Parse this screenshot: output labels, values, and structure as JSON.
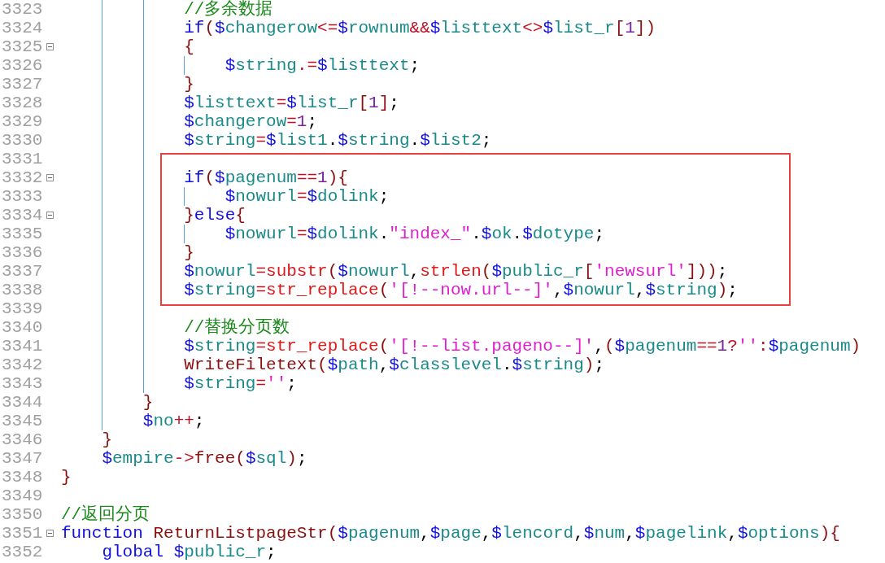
{
  "editor": {
    "blocks": [
      {
        "highlighted": false,
        "lines": [
          {
            "number": "3323",
            "tokens": [
              {
                "kind": "comment",
                "text": "            //多余数据"
              }
            ]
          },
          {
            "number": "3324",
            "tokens": [
              {
                "kind": "keyword",
                "text": "            if"
              },
              {
                "kind": "bracket",
                "text": "("
              },
              {
                "kind": "variable",
                "text": "$changerow"
              },
              {
                "kind": "operator",
                "text": "<="
              },
              {
                "kind": "variable",
                "text": "$rownum"
              },
              {
                "kind": "operator",
                "text": "&&"
              },
              {
                "kind": "variable",
                "text": "$listtext"
              },
              {
                "kind": "operator",
                "text": "<>"
              },
              {
                "kind": "variable",
                "text": "$list_r"
              },
              {
                "kind": "bracket",
                "text": "["
              },
              {
                "kind": "number",
                "text": "1"
              },
              {
                "kind": "bracket",
                "text": "]"
              },
              {
                "kind": "bracket",
                "text": ")"
              }
            ]
          },
          {
            "number": "3325",
            "fold": true,
            "tokens": [
              {
                "kind": "bracket",
                "text": "            {"
              }
            ]
          },
          {
            "number": "3326",
            "tokens": [
              {
                "kind": "variable",
                "text": "                $string"
              },
              {
                "kind": "operator",
                "text": ".="
              },
              {
                "kind": "variable",
                "text": "$listtext"
              },
              {
                "kind": "plain",
                "text": ";"
              }
            ]
          },
          {
            "number": "3327",
            "tokens": [
              {
                "kind": "bracket",
                "text": "            }"
              }
            ]
          },
          {
            "number": "3328",
            "tokens": [
              {
                "kind": "variable",
                "text": "            $listtext"
              },
              {
                "kind": "operator",
                "text": "="
              },
              {
                "kind": "variable",
                "text": "$list_r"
              },
              {
                "kind": "bracket",
                "text": "["
              },
              {
                "kind": "number",
                "text": "1"
              },
              {
                "kind": "bracket",
                "text": "]"
              },
              {
                "kind": "plain",
                "text": ";"
              }
            ]
          },
          {
            "number": "3329",
            "tokens": [
              {
                "kind": "variable",
                "text": "            $changerow"
              },
              {
                "kind": "operator",
                "text": "="
              },
              {
                "kind": "number",
                "text": "1"
              },
              {
                "kind": "plain",
                "text": ";"
              }
            ]
          },
          {
            "number": "3330",
            "tokens": [
              {
                "kind": "variable",
                "text": "            $string"
              },
              {
                "kind": "operator",
                "text": "="
              },
              {
                "kind": "variable",
                "text": "$list1"
              },
              {
                "kind": "plain",
                "text": "."
              },
              {
                "kind": "variable",
                "text": "$string"
              },
              {
                "kind": "plain",
                "text": "."
              },
              {
                "kind": "variable",
                "text": "$list2"
              },
              {
                "kind": "plain",
                "text": ";"
              }
            ]
          }
        ]
      },
      {
        "highlighted": true,
        "lines": [
          {
            "number": "3331"
          },
          {
            "number": "3332",
            "fold": true,
            "tokens": [
              {
                "kind": "keyword",
                "text": "            if"
              },
              {
                "kind": "bracket",
                "text": "("
              },
              {
                "kind": "variable",
                "text": "$pagenum"
              },
              {
                "kind": "operator",
                "text": "=="
              },
              {
                "kind": "number",
                "text": "1"
              },
              {
                "kind": "bracket",
                "text": ")"
              },
              {
                "kind": "bracket",
                "text": "{"
              }
            ]
          },
          {
            "number": "3333",
            "tokens": [
              {
                "kind": "variable",
                "text": "                $nowurl"
              },
              {
                "kind": "operator",
                "text": "="
              },
              {
                "kind": "variable",
                "text": "$dolink"
              },
              {
                "kind": "plain",
                "text": ";"
              }
            ]
          },
          {
            "number": "3334",
            "fold": true,
            "tokens": [
              {
                "kind": "bracket",
                "text": "            }"
              },
              {
                "kind": "keyword",
                "text": "else"
              },
              {
                "kind": "bracket",
                "text": "{"
              }
            ]
          },
          {
            "number": "3335",
            "tokens": [
              {
                "kind": "variable",
                "text": "                $nowurl"
              },
              {
                "kind": "operator",
                "text": "="
              },
              {
                "kind": "variable",
                "text": "$dolink"
              },
              {
                "kind": "plain",
                "text": "."
              },
              {
                "kind": "string",
                "text": "\"index_\""
              },
              {
                "kind": "plain",
                "text": "."
              },
              {
                "kind": "variable",
                "text": "$ok"
              },
              {
                "kind": "plain",
                "text": "."
              },
              {
                "kind": "variable",
                "text": "$dotype"
              },
              {
                "kind": "plain",
                "text": ";"
              }
            ]
          },
          {
            "number": "3336",
            "tokens": [
              {
                "kind": "bracket",
                "text": "            }"
              }
            ]
          },
          {
            "number": "3337",
            "tokens": [
              {
                "kind": "variable",
                "text": "            $nowurl"
              },
              {
                "kind": "operator",
                "text": "="
              },
              {
                "kind": "builtin",
                "text": "substr"
              },
              {
                "kind": "bracket",
                "text": "("
              },
              {
                "kind": "variable",
                "text": "$nowurl"
              },
              {
                "kind": "plain",
                "text": ","
              },
              {
                "kind": "builtin",
                "text": "strlen"
              },
              {
                "kind": "bracket",
                "text": "("
              },
              {
                "kind": "variable",
                "text": "$public_r"
              },
              {
                "kind": "bracket",
                "text": "["
              },
              {
                "kind": "string",
                "text": "'newsurl'"
              },
              {
                "kind": "bracket",
                "text": "]"
              },
              {
                "kind": "bracket",
                "text": ")"
              },
              {
                "kind": "bracket",
                "text": ")"
              },
              {
                "kind": "plain",
                "text": ";"
              }
            ]
          },
          {
            "number": "3338",
            "tokens": [
              {
                "kind": "variable",
                "text": "            $string"
              },
              {
                "kind": "operator",
                "text": "="
              },
              {
                "kind": "builtin",
                "text": "str_replace"
              },
              {
                "kind": "bracket",
                "text": "("
              },
              {
                "kind": "string",
                "text": "'[!--now.url--]'"
              },
              {
                "kind": "plain",
                "text": ","
              },
              {
                "kind": "variable",
                "text": "$nowurl"
              },
              {
                "kind": "plain",
                "text": ","
              },
              {
                "kind": "variable",
                "text": "$string"
              },
              {
                "kind": "bracket",
                "text": ")"
              },
              {
                "kind": "plain",
                "text": ";"
              }
            ]
          }
        ]
      },
      {
        "highlighted": false,
        "lines": [
          {
            "number": "3339"
          },
          {
            "number": "3340",
            "tokens": [
              {
                "kind": "comment",
                "text": "            //替换分页数"
              }
            ]
          },
          {
            "number": "3341",
            "tokens": [
              {
                "kind": "variable",
                "text": "            $string"
              },
              {
                "kind": "operator",
                "text": "="
              },
              {
                "kind": "builtin",
                "text": "str_replace"
              },
              {
                "kind": "bracket",
                "text": "("
              },
              {
                "kind": "string",
                "text": "'[!--list.pageno--]'"
              },
              {
                "kind": "plain",
                "text": ","
              },
              {
                "kind": "bracket",
                "text": "("
              },
              {
                "kind": "variable",
                "text": "$pagenum"
              },
              {
                "kind": "operator",
                "text": "=="
              },
              {
                "kind": "number",
                "text": "1"
              },
              {
                "kind": "operator",
                "text": "?"
              },
              {
                "kind": "string",
                "text": "''"
              },
              {
                "kind": "operator",
                "text": ":"
              },
              {
                "kind": "variable",
                "text": "$pagenum"
              },
              {
                "kind": "bracket",
                "text": ")"
              }
            ]
          },
          {
            "number": "3342",
            "tokens": [
              {
                "kind": "function",
                "text": "            WriteFiletext"
              },
              {
                "kind": "bracket",
                "text": "("
              },
              {
                "kind": "variable",
                "text": "$path"
              },
              {
                "kind": "plain",
                "text": ","
              },
              {
                "kind": "variable",
                "text": "$classlevel"
              },
              {
                "kind": "plain",
                "text": "."
              },
              {
                "kind": "variable",
                "text": "$string"
              },
              {
                "kind": "bracket",
                "text": ")"
              },
              {
                "kind": "plain",
                "text": ";"
              }
            ]
          },
          {
            "number": "3343",
            "tokens": [
              {
                "kind": "variable",
                "text": "            $string"
              },
              {
                "kind": "operator",
                "text": "="
              },
              {
                "kind": "string",
                "text": "''"
              },
              {
                "kind": "plain",
                "text": ";"
              }
            ]
          },
          {
            "number": "3344",
            "tokens": [
              {
                "kind": "bracket",
                "text": "        }"
              }
            ]
          },
          {
            "number": "3345",
            "tokens": [
              {
                "kind": "variable",
                "text": "        $no"
              },
              {
                "kind": "operator",
                "text": "++"
              },
              {
                "kind": "plain",
                "text": ";"
              }
            ]
          },
          {
            "number": "3346",
            "tokens": [
              {
                "kind": "bracket",
                "text": "    }"
              }
            ]
          },
          {
            "number": "3347",
            "tokens": [
              {
                "kind": "variable",
                "text": "    $empire"
              },
              {
                "kind": "operator",
                "text": "->"
              },
              {
                "kind": "function",
                "text": "free"
              },
              {
                "kind": "bracket",
                "text": "("
              },
              {
                "kind": "variable",
                "text": "$sql"
              },
              {
                "kind": "bracket",
                "text": ")"
              },
              {
                "kind": "plain",
                "text": ";"
              }
            ]
          },
          {
            "number": "3348",
            "tokens": [
              {
                "kind": "bracket",
                "text": "}"
              }
            ]
          },
          {
            "number": "3349"
          },
          {
            "number": "3350",
            "tokens": [
              {
                "kind": "comment",
                "text": "//返回分页"
              }
            ]
          },
          {
            "number": "3351",
            "fold": true,
            "tokens": [
              {
                "kind": "keyword",
                "text": "function"
              },
              {
                "kind": "function",
                "text": " ReturnListpageStr"
              },
              {
                "kind": "bracket",
                "text": "("
              },
              {
                "kind": "variable",
                "text": "$pagenum"
              },
              {
                "kind": "plain",
                "text": ","
              },
              {
                "kind": "variable",
                "text": "$page"
              },
              {
                "kind": "plain",
                "text": ","
              },
              {
                "kind": "variable",
                "text": "$lencord"
              },
              {
                "kind": "plain",
                "text": ","
              },
              {
                "kind": "variable",
                "text": "$num"
              },
              {
                "kind": "plain",
                "text": ","
              },
              {
                "kind": "variable",
                "text": "$pagelink"
              },
              {
                "kind": "plain",
                "text": ","
              },
              {
                "kind": "variable",
                "text": "$options"
              },
              {
                "kind": "bracket",
                "text": ")"
              },
              {
                "kind": "bracket",
                "text": "{"
              }
            ]
          },
          {
            "number": "3352",
            "tokens": [
              {
                "kind": "keyword",
                "text": "    global"
              },
              {
                "kind": "variable",
                "text": " $public_r"
              },
              {
                "kind": "plain",
                "text": ";"
              }
            ]
          }
        ]
      }
    ]
  }
}
